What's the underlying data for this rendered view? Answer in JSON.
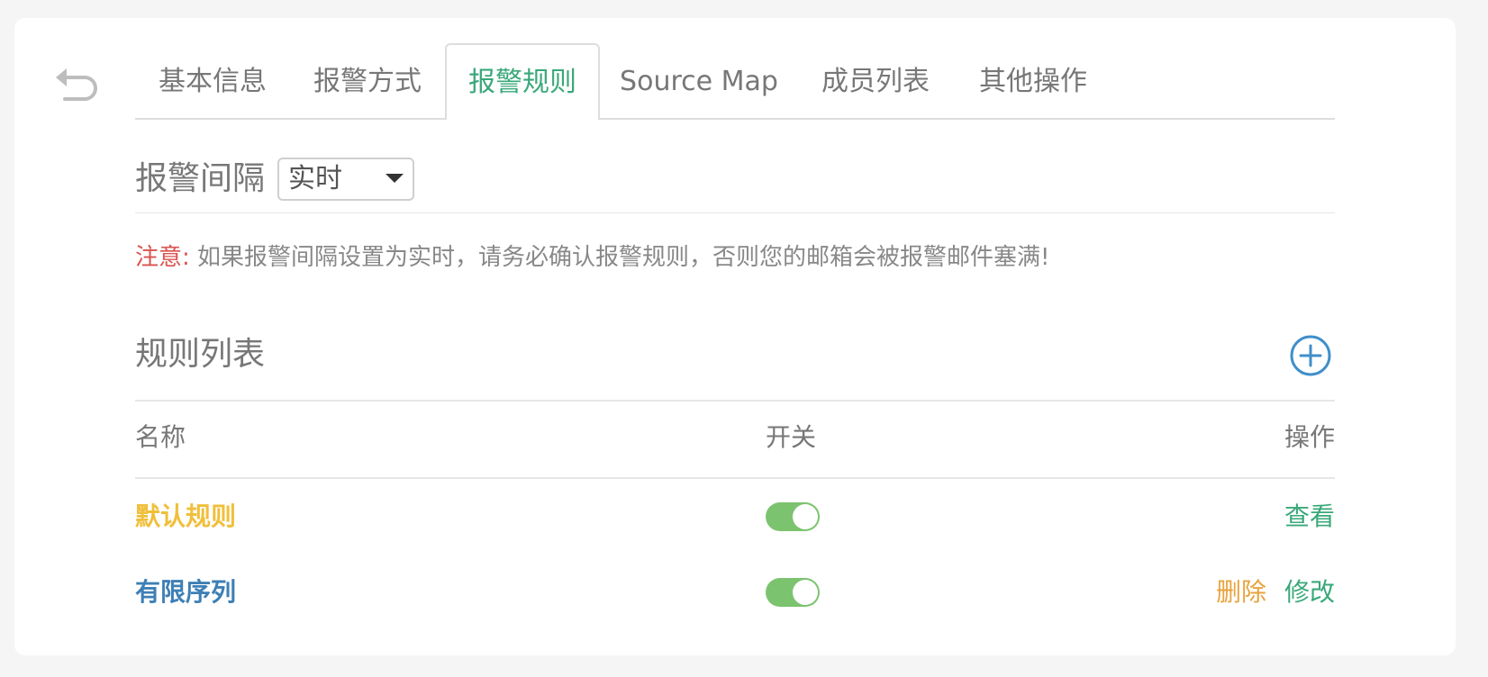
{
  "tabs": [
    {
      "label": "基本信息",
      "active": false
    },
    {
      "label": "报警方式",
      "active": false
    },
    {
      "label": "报警规则",
      "active": true
    },
    {
      "label": "Source Map",
      "active": false
    },
    {
      "label": "成员列表",
      "active": false
    },
    {
      "label": "其他操作",
      "active": false
    }
  ],
  "interval": {
    "label": "报警间隔",
    "selected": "实时"
  },
  "notice": {
    "prefix": "注意:",
    "text": " 如果报警间隔设置为实时，请务必确认报警规则，否则您的邮箱会被报警邮件塞满!"
  },
  "rules": {
    "title": "规则列表",
    "columns": {
      "name": "名称",
      "switch": "开关",
      "action": "操作"
    },
    "rows": [
      {
        "name": "默认规则",
        "name_color": "#f0bf3a",
        "enabled": true,
        "actions": [
          {
            "label": "查看",
            "color": "#3aa87a"
          }
        ]
      },
      {
        "name": "有限序列",
        "name_color": "#3e7fb5",
        "enabled": true,
        "actions": [
          {
            "label": "删除",
            "color": "#e8a33d"
          },
          {
            "label": "修改",
            "color": "#3aa87a"
          }
        ]
      }
    ]
  },
  "colors": {
    "accent_green": "#3aa87a",
    "toggle_on": "#7cc36f",
    "warning_red": "#d9534f",
    "add_icon_blue": "#3f8fca"
  },
  "icons": {
    "back": "undo-arrow-icon",
    "add": "plus-circle-icon"
  }
}
